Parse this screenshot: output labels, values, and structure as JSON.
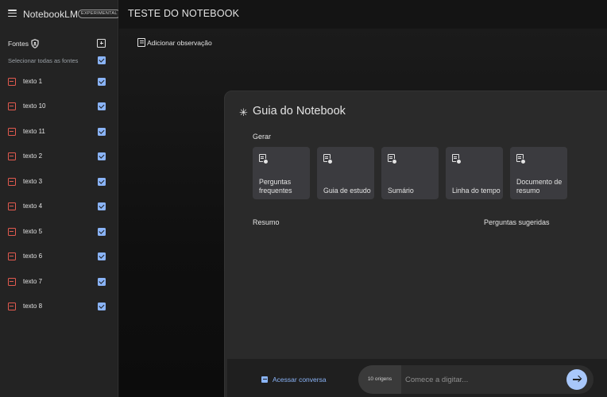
{
  "app": {
    "name": "NotebookLM",
    "badge": "EXPERIMENTAL",
    "notebook_title": "TESTE DO NOTEBOOK"
  },
  "sidebar": {
    "sources_title": "Fontes",
    "select_all_label": "Selecionar todas as fontes",
    "select_all_checked": true,
    "items": [
      {
        "label": "texto 1",
        "checked": true
      },
      {
        "label": "texto 10",
        "checked": true
      },
      {
        "label": "texto 11",
        "checked": true
      },
      {
        "label": "texto 2",
        "checked": true
      },
      {
        "label": "texto 3",
        "checked": true
      },
      {
        "label": "texto 4",
        "checked": true
      },
      {
        "label": "texto 5",
        "checked": true
      },
      {
        "label": "texto 6",
        "checked": true
      },
      {
        "label": "texto 7",
        "checked": true
      },
      {
        "label": "texto 8",
        "checked": true
      }
    ]
  },
  "main": {
    "add_note_label": "Adicionar observação"
  },
  "guide": {
    "title": "Guia do Notebook",
    "generate_label": "Gerar",
    "cards": [
      {
        "label": "Perguntas frequentes"
      },
      {
        "label": "Guia de estudo"
      },
      {
        "label": "Sumário"
      },
      {
        "label": "Linha do tempo"
      },
      {
        "label": "Documento de resumo"
      }
    ],
    "summary_label": "Resumo",
    "suggested_questions_label": "Perguntas sugeridas"
  },
  "chat": {
    "open_chat_label": "Acessar conversa",
    "origins_label": "10 origens",
    "input_placeholder": "Comece a digitar..."
  },
  "colors": {
    "accent": "#8ab4f8",
    "send_button": "#a8c7fa",
    "source_icon": "#e35a4f"
  }
}
